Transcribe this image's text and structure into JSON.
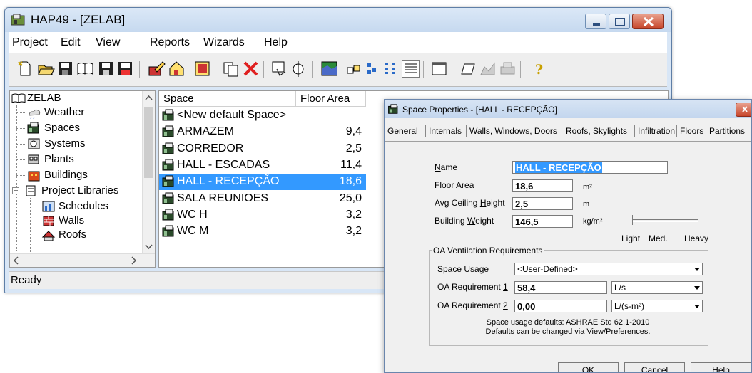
{
  "window": {
    "title": "HAP49 - [ZELAB]"
  },
  "menu": [
    "Project",
    "Edit",
    "View",
    "Reports",
    "Wizards",
    "Help"
  ],
  "tree": {
    "root": "ZELAB",
    "items": [
      "Weather",
      "Spaces",
      "Systems",
      "Plants",
      "Buildings",
      "Project Libraries"
    ],
    "children": [
      "Schedules",
      "Walls",
      "Roofs"
    ]
  },
  "list": {
    "columns": [
      "Space",
      "Floor Area"
    ],
    "rows": [
      {
        "name": "<New default Space>",
        "area": ""
      },
      {
        "name": "ARMAZEM",
        "area": "9,4"
      },
      {
        "name": "CORREDOR",
        "area": "2,5"
      },
      {
        "name": "HALL - ESCADAS",
        "area": "11,4"
      },
      {
        "name": "HALL - RECEPÇÃO",
        "area": "18,6"
      },
      {
        "name": "SALA REUNIOES",
        "area": "25,0"
      },
      {
        "name": "WC H",
        "area": "3,2"
      },
      {
        "name": "WC M",
        "area": "3,2"
      }
    ],
    "selected_index": 4
  },
  "status": "Ready",
  "dialog": {
    "title": "Space Properties - [HALL - RECEPÇÃO]",
    "tabs": [
      "General",
      "Internals",
      "Walls, Windows, Doors",
      "Roofs, Skylights",
      "Infiltration",
      "Floors",
      "Partitions"
    ],
    "fields": {
      "name_label_pre": "N",
      "name_label_post": "ame",
      "name_value": "HALL - RECEPÇÃO",
      "floor_label_pre": "F",
      "floor_label_post": "loor Area",
      "floor_value": "18,6",
      "floor_unit": "m²",
      "ceiling_label_pre": "Avg Ceiling ",
      "ceiling_label_u": "H",
      "ceiling_label_post": "eight",
      "ceiling_value": "2,5",
      "ceiling_unit": "m",
      "weight_label_pre": "Building ",
      "weight_label_u": "W",
      "weight_label_post": "eight",
      "weight_value": "146,5",
      "weight_unit": "kg/m²"
    },
    "slider_labels": [
      "Light",
      "Med.",
      "Heavy"
    ],
    "oa": {
      "group_title": "OA Ventilation Requirements",
      "usage_label_pre": "Space ",
      "usage_label_u": "U",
      "usage_label_post": "sage",
      "usage_value": "<User-Defined>",
      "req1_label_pre": "OA Requirement ",
      "req1_label_u": "1",
      "req1_value": "58,4",
      "req1_unit": "L/s",
      "req2_label_pre": "OA Requirement ",
      "req2_label_u": "2",
      "req2_value": "0,00",
      "req2_unit": "L/(s-m²)",
      "note1": "Space usage defaults: ASHRAE Std 62.1-2010",
      "note2": "Defaults can be changed via View/Preferences."
    },
    "buttons": {
      "ok": "OK",
      "cancel": "Cancel",
      "help_u": "H",
      "help_post": "elp"
    }
  }
}
